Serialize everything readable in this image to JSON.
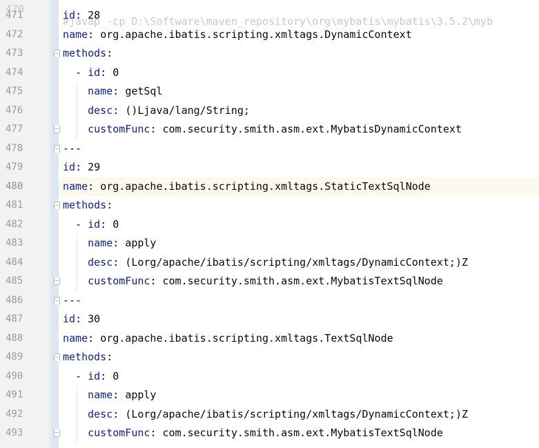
{
  "editor": {
    "partial_top_line": {
      "number": "470",
      "text": "#javap -cp D:\\Software\\maven_repository\\org\\mybatis\\mybatis\\3.5.2\\myb"
    },
    "active_line": "480",
    "lines": [
      {
        "num": "471",
        "indent": 0,
        "key": "id",
        "sep": ": ",
        "val": "28",
        "fold": ""
      },
      {
        "num": "472",
        "indent": 0,
        "key": "name",
        "sep": ": ",
        "val": "org.apache.ibatis.scripting.xmltags.DynamicContext",
        "fold": ""
      },
      {
        "num": "473",
        "indent": 0,
        "key": "methods",
        "sep": ":",
        "val": "",
        "fold": "open"
      },
      {
        "num": "474",
        "indent": 1,
        "key": "id",
        "sep": ": ",
        "val": "0",
        "fold": "",
        "dash": "- "
      },
      {
        "num": "475",
        "indent": 2,
        "key": "name",
        "sep": ": ",
        "val": "getSql",
        "fold": ""
      },
      {
        "num": "476",
        "indent": 2,
        "key": "desc",
        "sep": ": ",
        "val": "()Ljava/lang/String;",
        "fold": ""
      },
      {
        "num": "477",
        "indent": 2,
        "key": "customFunc",
        "sep": ": ",
        "val": "com.security.smith.asm.ext.MybatisDynamicContext",
        "fold": "close"
      },
      {
        "num": "478",
        "indent": 0,
        "key": "",
        "sep": "",
        "val": "---",
        "fold": "open"
      },
      {
        "num": "479",
        "indent": 0,
        "key": "id",
        "sep": ": ",
        "val": "29",
        "fold": ""
      },
      {
        "num": "480",
        "indent": 0,
        "key": "name",
        "sep": ": ",
        "val": "org.apache.ibatis.scripting.xmltags.StaticTextSqlNode",
        "fold": ""
      },
      {
        "num": "481",
        "indent": 0,
        "key": "methods",
        "sep": ":",
        "val": "",
        "fold": "open"
      },
      {
        "num": "482",
        "indent": 1,
        "key": "id",
        "sep": ": ",
        "val": "0",
        "fold": "",
        "dash": "- "
      },
      {
        "num": "483",
        "indent": 2,
        "key": "name",
        "sep": ": ",
        "val": "apply",
        "fold": ""
      },
      {
        "num": "484",
        "indent": 2,
        "key": "desc",
        "sep": ": ",
        "val": "(Lorg/apache/ibatis/scripting/xmltags/DynamicContext;)Z",
        "fold": ""
      },
      {
        "num": "485",
        "indent": 2,
        "key": "customFunc",
        "sep": ": ",
        "val": "com.security.smith.asm.ext.MybatisTextSqlNode",
        "fold": "close"
      },
      {
        "num": "486",
        "indent": 0,
        "key": "",
        "sep": "",
        "val": "---",
        "fold": "open"
      },
      {
        "num": "487",
        "indent": 0,
        "key": "id",
        "sep": ": ",
        "val": "30",
        "fold": ""
      },
      {
        "num": "488",
        "indent": 0,
        "key": "name",
        "sep": ": ",
        "val": "org.apache.ibatis.scripting.xmltags.TextSqlNode",
        "fold": ""
      },
      {
        "num": "489",
        "indent": 0,
        "key": "methods",
        "sep": ":",
        "val": "",
        "fold": "open"
      },
      {
        "num": "490",
        "indent": 1,
        "key": "id",
        "sep": ": ",
        "val": "0",
        "fold": "",
        "dash": "- "
      },
      {
        "num": "491",
        "indent": 2,
        "key": "name",
        "sep": ": ",
        "val": "apply",
        "fold": ""
      },
      {
        "num": "492",
        "indent": 2,
        "key": "desc",
        "sep": ": ",
        "val": "(Lorg/apache/ibatis/scripting/xmltags/DynamicContext;)Z",
        "fold": ""
      },
      {
        "num": "493",
        "indent": 2,
        "key": "customFunc",
        "sep": ": ",
        "val": "com.security.smith.asm.ext.MybatisTextSqlNode",
        "fold": "close"
      }
    ]
  }
}
